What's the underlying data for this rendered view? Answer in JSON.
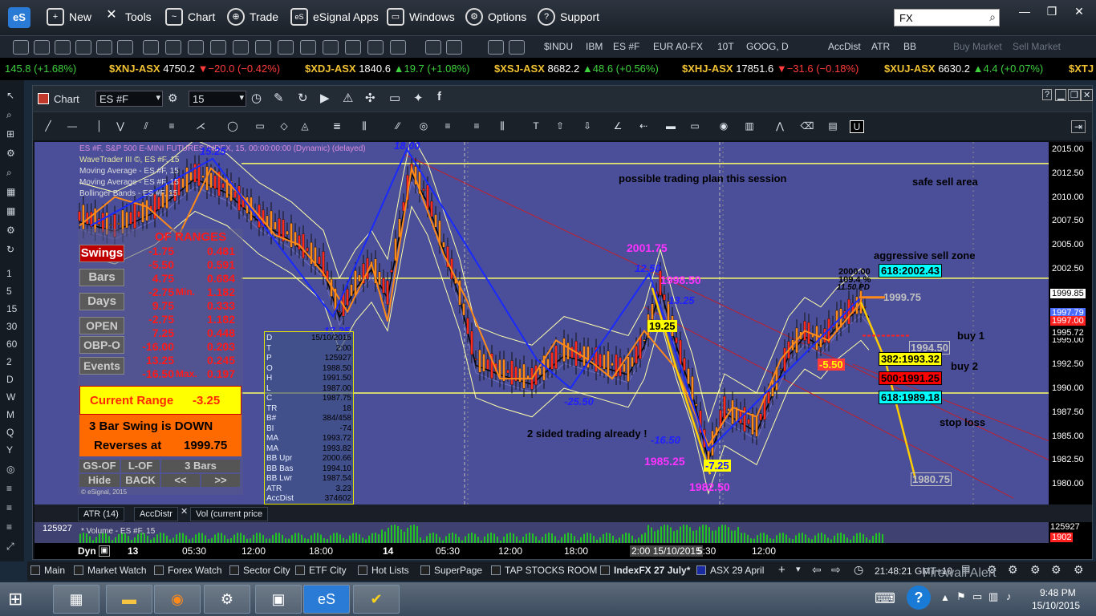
{
  "app": {
    "logo": "eS",
    "menu": [
      "New",
      "Tools",
      "Chart",
      "Trade",
      "eSignal Apps",
      "Windows",
      "Options",
      "Support"
    ],
    "search_value": "FX"
  },
  "quote_toolbar": {
    "symbols": [
      "$INDU",
      "IBM",
      "ES #F",
      "EUR A0-FX",
      "10T",
      "GOOG, D",
      "AccDist",
      "ATR",
      "BB"
    ],
    "disabled": [
      "Buy Market",
      "Sell Market"
    ]
  },
  "ticker": [
    {
      "name": "",
      "price": "145.8 (+1.68%)",
      "dir": "up",
      "change": ""
    },
    {
      "name": "$XNJ-ASX",
      "price": "4750.2",
      "dir": "down",
      "change": "−20.0 (−0.42%)"
    },
    {
      "name": "$XDJ-ASX",
      "price": "1840.6",
      "dir": "up",
      "change": "19.7 (+1.08%)"
    },
    {
      "name": "$XSJ-ASX",
      "price": "8682.2",
      "dir": "up",
      "change": "48.6 (+0.56%)"
    },
    {
      "name": "$XHJ-ASX",
      "price": "17851.6",
      "dir": "down",
      "change": "−31.6 (−0.18%)"
    },
    {
      "name": "$XUJ-ASX",
      "price": "6630.2",
      "dir": "up",
      "change": "4.4 (+0.07%)"
    },
    {
      "name": "$XTJ",
      "price": "",
      "dir": "",
      "change": ""
    }
  ],
  "left_sidebar": [
    "1",
    "5",
    "15",
    "30",
    "60",
    "2",
    "D",
    "W",
    "M",
    "Q",
    "Y"
  ],
  "chart": {
    "title": "Chart",
    "symbol": "ES #F",
    "interval": "15",
    "header_lines": [
      "ES #F, S&P 500 E-MINI FUTURES INDEX, 15, 00:00:00:00 (Dynamic) (delayed)",
      "WaveTrader III ©, ES #F, 15",
      "Moving Average - ES #F, 15",
      "Moving Average - ES #F, 15",
      "Bollinger Bands - ES #F, 15"
    ],
    "price_ticks": [
      "2015.00",
      "2012.50",
      "2010.00",
      "2007.50",
      "2005.00",
      "2002.50",
      "2000.00",
      "1997.50",
      "1995.00",
      "1992.50",
      "1990.00",
      "1987.50",
      "1985.00",
      "1982.50",
      "1980.00"
    ],
    "price_labels": [
      {
        "value": "1999.85",
        "bg": "#ffffff",
        "fg": "#000000"
      },
      {
        "value": "1997.79",
        "bg": "#4a6cff",
        "fg": "#ffffff"
      },
      {
        "value": "1997.00",
        "bg": "#ff2020",
        "fg": "#ffffff"
      },
      {
        "value": "1995.72",
        "bg": "#000000",
        "fg": "#ffffff"
      }
    ],
    "annotations": {
      "plan": "possible trading plan this session",
      "safe_sell": "safe sell area",
      "aggressive": "aggressive sell zone",
      "buy1": "buy 1",
      "buy2": "buy 2",
      "stop": "stop loss",
      "two_sided": "2 sided trading already !"
    },
    "wave_labels": {
      "w1": "15.25",
      "w2": "18.00",
      "w3": "-17.25",
      "w4": "-25.50",
      "w5": "2001.75",
      "w6": "12.50",
      "w7": "1998.50",
      "w8": "13.25",
      "w9": "19.25",
      "w10": "-16.50",
      "w11": "1985.25",
      "w12": "-7.25",
      "w13": "1982.50",
      "w14": "-5.50",
      "w15": "2000.00",
      "w16": "109.4 %",
      "w17": "11.50 PD",
      "w18": "1999.75",
      "w19": "1994.50",
      "w20": "1980.75"
    },
    "fib_boxes": [
      {
        "label": "618:2002.43",
        "bg": "#00ffff"
      },
      {
        "label": "382:1993.32",
        "bg": "#ffff00"
      },
      {
        "label": "500:1991.25",
        "bg": "#ff0000"
      },
      {
        "label": "618:1989.18",
        "bg": "#00ffff"
      }
    ],
    "ranges_panel": {
      "heading": "OF RANGES",
      "swings": "Swings",
      "bars": "Bars",
      "days": "Days",
      "open": "OPEN",
      "obpo": "OBP-O",
      "events": "Events",
      "left_vals": [
        "-1.75",
        "-5.50",
        "4.75",
        "-2.75",
        "9.75",
        "-2.75",
        "7.25",
        "-16.00",
        "13.25",
        "-16.50"
      ],
      "right_vals": [
        "0.481",
        "0.591",
        "0.684",
        "1.182",
        "0.333",
        "1.182",
        "0.448",
        "0.203",
        "0.245",
        "0.197"
      ],
      "min_label": "Min.",
      "max_label": "Max.",
      "current_range_label": "Current Range",
      "current_range_value": "-3.25",
      "swing_line1": "3 Bar Swing is DOWN",
      "swing_line2_label": "Reverses at",
      "swing_line2_value": "1999.75",
      "buttons": [
        "GS-OF",
        "L-OF",
        "3 Bars",
        "Hide",
        "BACK",
        "<<",
        ">>"
      ],
      "copyright": "© eSignal, 2015"
    },
    "data_window": {
      "rows": [
        {
          "k": "D",
          "v": "15/10/2015"
        },
        {
          "k": "T",
          "v": "2:00"
        },
        {
          "k": "P",
          "v": "125927"
        },
        {
          "k": "O",
          "v": "1988.50"
        },
        {
          "k": "H",
          "v": "1991.50"
        },
        {
          "k": "L",
          "v": "1987.00"
        },
        {
          "k": "C",
          "v": "1987.75"
        },
        {
          "k": "TR",
          "v": "18"
        },
        {
          "k": "B#",
          "v": "384/458"
        },
        {
          "k": "BI",
          "v": "-74"
        },
        {
          "k": "MA",
          "v": "1993.72"
        },
        {
          "k": "MA",
          "v": "1993.82"
        },
        {
          "k": "BB Upr",
          "v": "2000.66"
        },
        {
          "k": "BB Bas",
          "v": "1994.10"
        },
        {
          "k": "BB Lwr",
          "v": "1987.54"
        },
        {
          "k": "ATR",
          "v": "3.23"
        },
        {
          "k": "AccDist",
          "v": "374602"
        }
      ]
    },
    "lower_tabs": [
      "ATR (14)",
      "AccDistr",
      "Vol (current price"
    ],
    "volume_label": "* Volume - ES #F, 15",
    "volume_value": "125927",
    "vol_axis": [
      "125927",
      "1902"
    ],
    "time_labels": [
      "13",
      "05:30",
      "12:00",
      "18:00",
      "14",
      "05:30",
      "12:00",
      "18:00",
      "2:00 15/10/2015",
      "5:30",
      "12:00"
    ],
    "dyn_label": "Dyn"
  },
  "bottom_tabs": [
    "Main",
    "Market Watch",
    "Forex Watch",
    "Sector City",
    "ETF City",
    "Hot Lists",
    "SuperPage",
    "TAP STOCKS ROOM",
    "IndexFX 27 July*",
    "ASX 29 April"
  ],
  "clock": "21:48:21 GMT+10",
  "system": {
    "time": "9:48 PM",
    "date": "15/10/2015",
    "firewall": "Firewall Alert"
  }
}
